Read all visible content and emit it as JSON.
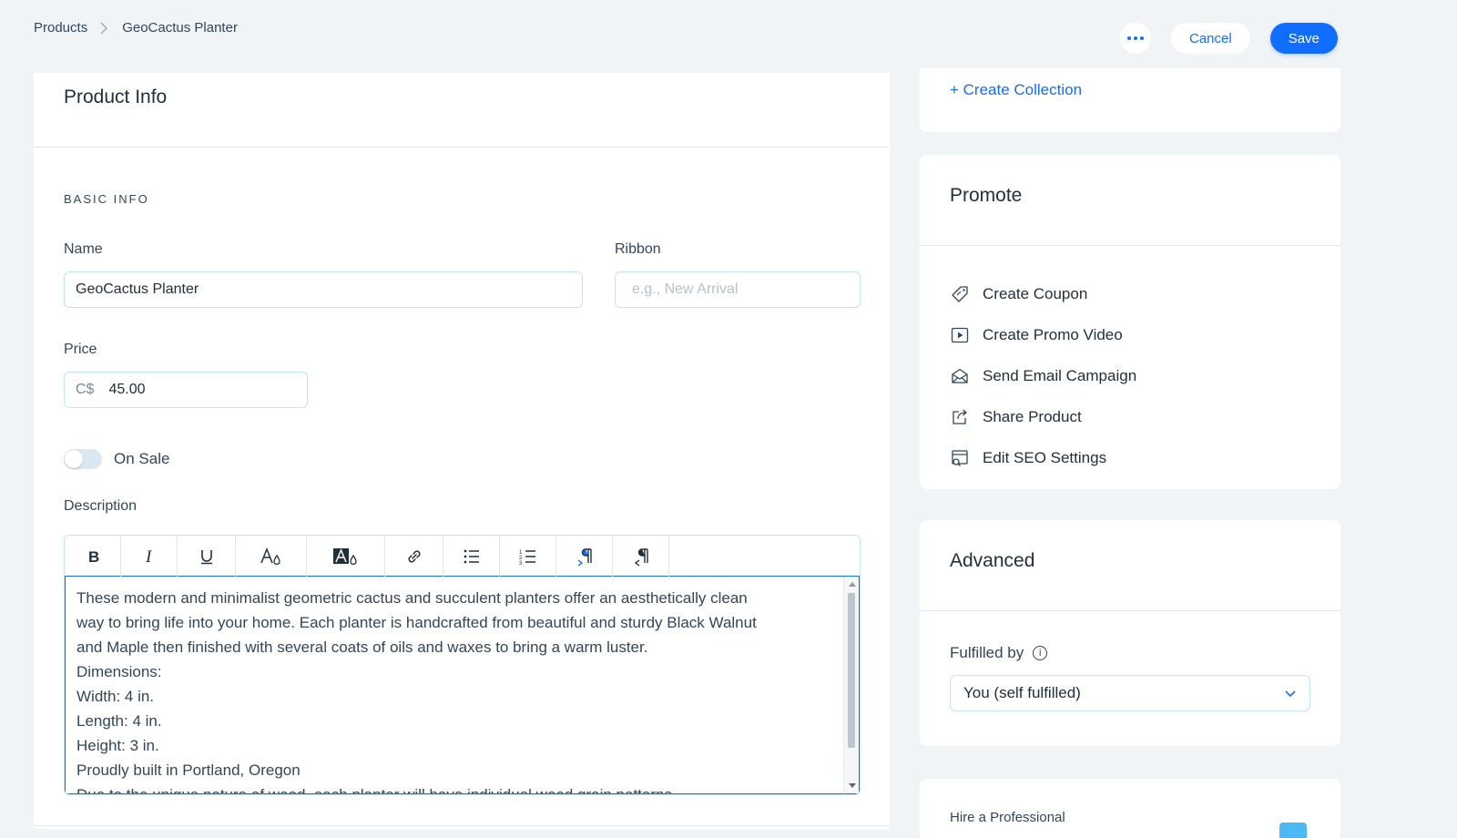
{
  "breadcrumb": {
    "parent": "Products",
    "current": "GeoCactus Planter"
  },
  "header": {
    "cancel_label": "Cancel",
    "save_label": "Save"
  },
  "product_info": {
    "title": "Product Info",
    "section_label": "BASIC INFO",
    "name_label": "Name",
    "name_value": "GeoCactus Planter",
    "ribbon_label": "Ribbon",
    "ribbon_placeholder": "e.g., New Arrival",
    "price_label": "Price",
    "price_currency": "C$",
    "price_value": "45.00",
    "on_sale_label": "On Sale",
    "on_sale_enabled": false,
    "description_label": "Description",
    "description_lines": [
      "These modern and minimalist geometric cactus and succulent planters offer an aesthetically clean",
      "way to bring life into your home. Each planter is handcrafted from beautiful and sturdy Black Walnut",
      "and Maple then finished with several coats of oils and waxes to bring a warm luster.",
      "Dimensions:",
      "Width: 4 in.",
      "Length: 4 in.",
      "Height: 3 in.",
      "Proudly built in Portland, Oregon",
      "Due to the unique nature of wood, each planter will have individual wood grain patterns."
    ],
    "toolbar": [
      "bold-icon",
      "italic-icon",
      "underline-icon",
      "text-color-icon",
      "highlight-color-icon",
      "link-icon",
      "bulleted-list-icon",
      "numbered-list-icon",
      "text-direction-ltr-icon",
      "text-direction-rtl-icon"
    ]
  },
  "collections": {
    "create_label": "+ Create Collection"
  },
  "promote": {
    "title": "Promote",
    "items": [
      {
        "label": "Create Coupon",
        "icon": "coupon-icon"
      },
      {
        "label": "Create Promo Video",
        "icon": "video-icon"
      },
      {
        "label": "Send Email Campaign",
        "icon": "email-icon"
      },
      {
        "label": "Share Product",
        "icon": "share-icon"
      },
      {
        "label": "Edit SEO Settings",
        "icon": "seo-icon"
      }
    ]
  },
  "advanced": {
    "title": "Advanced",
    "fulfilled_label": "Fulfilled by",
    "fulfilled_value": "You (self fulfilled)"
  },
  "hire": {
    "title": "Hire a Professional"
  },
  "colors": {
    "accent": "#116dff",
    "background": "#f0f4f7",
    "input_border": "#c1e4fe"
  }
}
